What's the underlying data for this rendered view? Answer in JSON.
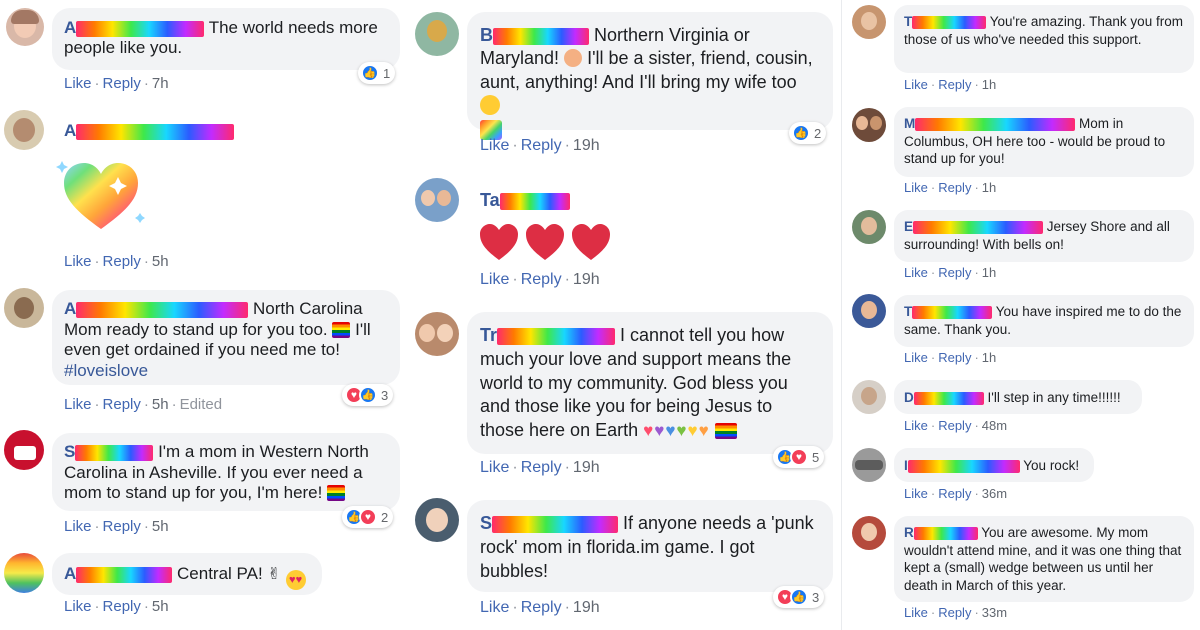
{
  "column1": [
    {
      "id": "c1",
      "text": "The world needs more people like you.",
      "actions": {
        "like": "Like",
        "reply": "Reply",
        "time": "7h"
      },
      "reaction_count": "1"
    },
    {
      "id": "c2",
      "text": "",
      "actions": {
        "like": "Like",
        "reply": "Reply",
        "time": "5h"
      }
    },
    {
      "id": "c3",
      "text_a": "North Carolina Mom ready to stand up for you too.",
      "text_b": "I'll even get ordained if you need me to!",
      "hashtag": "#loveislove",
      "actions": {
        "like": "Like",
        "reply": "Reply",
        "time": "5h",
        "edited": "Edited"
      },
      "reaction_count": "3"
    },
    {
      "id": "c4",
      "text": "I'm a mom in Western North Carolina in Asheville. If you ever need a mom to stand up for you, I'm here!",
      "actions": {
        "like": "Like",
        "reply": "Reply",
        "time": "5h"
      },
      "reaction_count": "2"
    },
    {
      "id": "c5",
      "text": "Central PA!",
      "actions": {
        "like": "Like",
        "reply": "Reply",
        "time": "5h"
      }
    }
  ],
  "column2": [
    {
      "id": "c6",
      "text_a": "Northern Virginia or Maryland!",
      "text_b": "I'll be a sister, friend, cousin, aunt, anything! And I'll bring my wife too",
      "actions": {
        "like": "Like",
        "reply": "Reply",
        "time": "19h"
      },
      "reaction_count": "2"
    },
    {
      "id": "c7",
      "name_prefix": "Ta",
      "actions": {
        "like": "Like",
        "reply": "Reply",
        "time": "19h"
      }
    },
    {
      "id": "c8",
      "name_prefix": "Tr",
      "text": "I cannot tell you how much your love and support means the world to my community. God bless you and those like you for being Jesus to those here on Earth",
      "actions": {
        "like": "Like",
        "reply": "Reply",
        "time": "19h"
      },
      "reaction_count": "5"
    },
    {
      "id": "c9",
      "text": "If anyone needs a 'punk rock' mom in florida.im game. I got bubbles!",
      "actions": {
        "like": "Like",
        "reply": "Reply",
        "time": "19h"
      },
      "reaction_count": "3"
    }
  ],
  "column3": [
    {
      "id": "c10",
      "text": "You're amazing. Thank you from those of us who've needed this support.",
      "actions": {
        "like": "Like",
        "reply": "Reply",
        "time": "1h"
      }
    },
    {
      "id": "c11",
      "text": "Mom in Columbus, OH here too - would be proud to stand up for you!",
      "actions": {
        "like": "Like",
        "reply": "Reply",
        "time": "1h"
      }
    },
    {
      "id": "c12",
      "text": "Jersey Shore and all surrounding! With bells on!",
      "actions": {
        "like": "Like",
        "reply": "Reply",
        "time": "1h"
      }
    },
    {
      "id": "c13",
      "text": "You have inspired me to do the same. Thank you.",
      "actions": {
        "like": "Like",
        "reply": "Reply",
        "time": "1h"
      }
    },
    {
      "id": "c14",
      "text": "I'll step in any time!!!!!!",
      "actions": {
        "like": "Like",
        "reply": "Reply",
        "time": "48m"
      }
    },
    {
      "id": "c15",
      "text": "You rock!",
      "actions": {
        "like": "Like",
        "reply": "Reply",
        "time": "36m"
      }
    },
    {
      "id": "c16",
      "text": "You are awesome. My mom wouldn't attend mine, and it was one thing that kept a (small) wedge between us until her death in March of this year.",
      "actions": {
        "like": "Like",
        "reply": "Reply",
        "time": "33m"
      }
    }
  ],
  "name_initials": {
    "c1": "A",
    "c2": "A",
    "c3": "A",
    "c4": "S",
    "c5": "A",
    "c6": "B",
    "c9": "S",
    "c10": "T",
    "c11": "M",
    "c12": "E",
    "c13": "T",
    "c14": "D",
    "c15": "I",
    "c16": "R"
  },
  "colors": {
    "link": "#4267b2",
    "name": "#385898",
    "bubble": "#f2f3f5",
    "like_blue": "#1877f2",
    "love_red": "#f33e58",
    "heart_red": "#e0245e"
  }
}
